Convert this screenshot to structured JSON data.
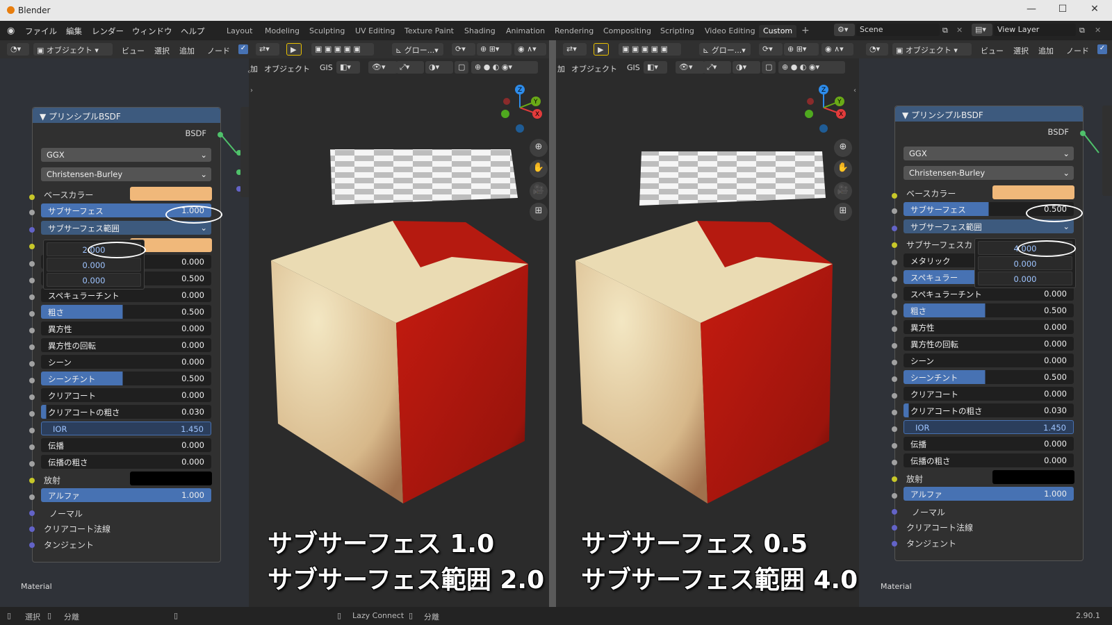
{
  "app": {
    "title": "Blender",
    "version": "2.90.1"
  },
  "menu": [
    "ファイル",
    "編集",
    "レンダー",
    "ウィンドウ",
    "ヘルプ"
  ],
  "workspaces": [
    "Layout",
    "Modeling",
    "Sculpting",
    "UV Editing",
    "Texture Paint",
    "Shading",
    "Animation",
    "Rendering",
    "Compositing",
    "Scripting",
    "Video Editing",
    "Custom"
  ],
  "active_workspace": "Custom",
  "scene": "Scene",
  "view_layer": "View Layer",
  "node_header": {
    "mode": "オブジェクト",
    "view": "ビュー",
    "select": "選択",
    "add": "追加",
    "node": "ノード"
  },
  "viewport_header": {
    "global": "グロー...",
    "add": "加",
    "object": "オブジェクト",
    "gis": "GIS"
  },
  "left_node": {
    "title": "プリンシプルBSDF",
    "output": "BSDF",
    "dist": "GGX",
    "sss_method": "Christensen-Burley",
    "base_color": "ベースカラー",
    "subsurface": {
      "label": "サブサーフェス",
      "value": "1.000"
    },
    "subsurface_radius": "サブサーフェス範囲",
    "radius_values": [
      "2.000",
      "0.000",
      "0.000"
    ],
    "rows": [
      {
        "label": "",
        "value": "0.000"
      },
      {
        "label": "",
        "value": "0.500"
      },
      {
        "label": "スペキュラーチント",
        "value": "0.000"
      },
      {
        "label": "粗さ",
        "value": "0.500"
      },
      {
        "label": "異方性",
        "value": "0.000"
      },
      {
        "label": "異方性の回転",
        "value": "0.000"
      },
      {
        "label": "シーン",
        "value": "0.000"
      },
      {
        "label": "シーンチント",
        "value": "0.500"
      },
      {
        "label": "クリアコート",
        "value": "0.000"
      },
      {
        "label": "クリアコートの粗さ",
        "value": "0.030"
      },
      {
        "label": "IOR",
        "value": "1.450"
      },
      {
        "label": "伝播",
        "value": "0.000"
      },
      {
        "label": "伝播の粗さ",
        "value": "0.000"
      }
    ],
    "emission": "放射",
    "alpha": {
      "label": "アルファ",
      "value": "1.000"
    },
    "normal": "ノーマル",
    "clearcoat_normal": "クリアコート法線",
    "tangent": "タンジェント",
    "footer": "Material"
  },
  "right_node": {
    "title": "プリンシプルBSDF",
    "output": "BSDF",
    "dist": "GGX",
    "sss_method": "Christensen-Burley",
    "base_color": "ベースカラー",
    "subsurface": {
      "label": "サブサーフェス",
      "value": "0.500"
    },
    "subsurface_radius": "サブサーフェス範囲",
    "subsurface_color": "サブサーフェスカ",
    "radius_values": [
      "4.000",
      "0.000",
      "0.000"
    ],
    "metallic": "メタリック",
    "specular": "スペキュラー",
    "rows": [
      {
        "label": "スペキュラーチント",
        "value": "0.000"
      },
      {
        "label": "粗さ",
        "value": "0.500"
      },
      {
        "label": "異方性",
        "value": "0.000"
      },
      {
        "label": "異方性の回転",
        "value": "0.000"
      },
      {
        "label": "シーン",
        "value": "0.000"
      },
      {
        "label": "シーンチント",
        "value": "0.500"
      },
      {
        "label": "クリアコート",
        "value": "0.000"
      },
      {
        "label": "クリアコートの粗さ",
        "value": "0.030"
      },
      {
        "label": "IOR",
        "value": "1.450"
      },
      {
        "label": "伝播",
        "value": "0.000"
      },
      {
        "label": "伝播の粗さ",
        "value": "0.000"
      }
    ],
    "emission": "放射",
    "alpha": {
      "label": "アルファ",
      "value": "1.000"
    },
    "normal": "ノーマル",
    "clearcoat_normal": "クリアコート法線",
    "tangent": "タンジェント",
    "footer": "Material"
  },
  "captions": {
    "left_line1": "サブサーフェス 1.0",
    "left_line2": "サブサーフェス範囲 2.0",
    "right_line1": "サブサーフェス 0.5",
    "right_line2": "サブサーフェス範囲 4.0"
  },
  "statusbar": {
    "select": "選択",
    "detach": "分離",
    "lazy_connect": "Lazy Connect",
    "detach2": "分離"
  },
  "colors": {
    "base_color": "#f0b87a",
    "cube_red": "#c41f12",
    "cube_cream": "#ead9b0",
    "accent": "#4772b3"
  }
}
